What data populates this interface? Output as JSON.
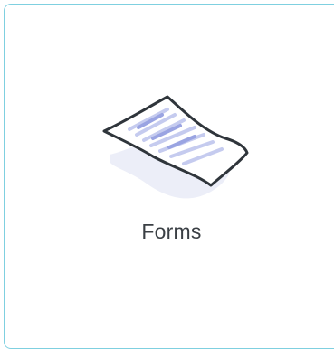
{
  "card": {
    "label": "Forms",
    "icon": "document-paper-icon",
    "border_color": "#7fd0e0",
    "text_color": "#3a3f44"
  }
}
